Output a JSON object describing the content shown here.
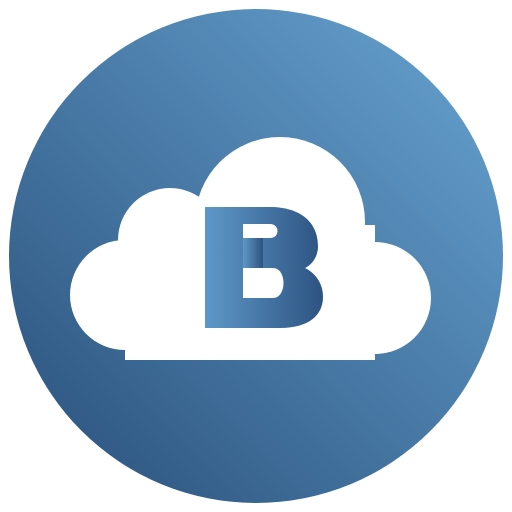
{
  "icon": {
    "name": "cloud-b-app-icon",
    "logo_letter": "B",
    "colors": {
      "circle_light": "#68a4d2",
      "circle_dark": "#294f7a",
      "cloud": "#ffffff",
      "letter_light": "#5e98c8",
      "letter_dark": "#2d5381"
    }
  }
}
